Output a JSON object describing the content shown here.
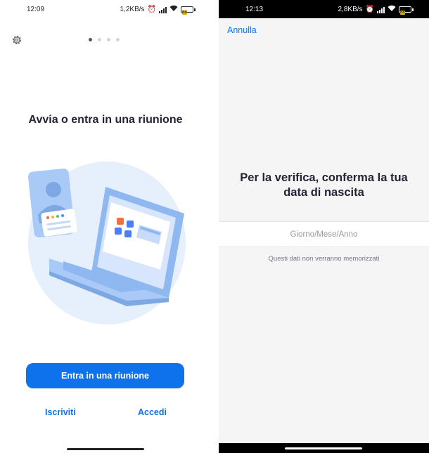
{
  "left_screen": {
    "status": {
      "time": "12:09",
      "speed": "1,2KB/s",
      "battery": "88"
    },
    "title": "Avvia o entra in una riunione",
    "primary_button": "Entra in una riunione",
    "signup_link": "Iscriviti",
    "login_link": "Accedi",
    "page_indicator": {
      "total": 4,
      "current": 1
    }
  },
  "right_screen": {
    "status": {
      "time": "12:13",
      "speed": "2,8KB/s",
      "battery": "88"
    },
    "cancel_link": "Annulla",
    "title_line1": "Per la verifica, conferma la tua",
    "title_line2": "data di nascita",
    "dob_placeholder": "Giorno/Mese/Anno",
    "note": "Questi dati non verranno memorizzati"
  },
  "colors": {
    "accent": "#0e72ed",
    "title": "#232333",
    "illustration_light": "#e6f0fd",
    "illustration_mid": "#a9c9f6"
  }
}
